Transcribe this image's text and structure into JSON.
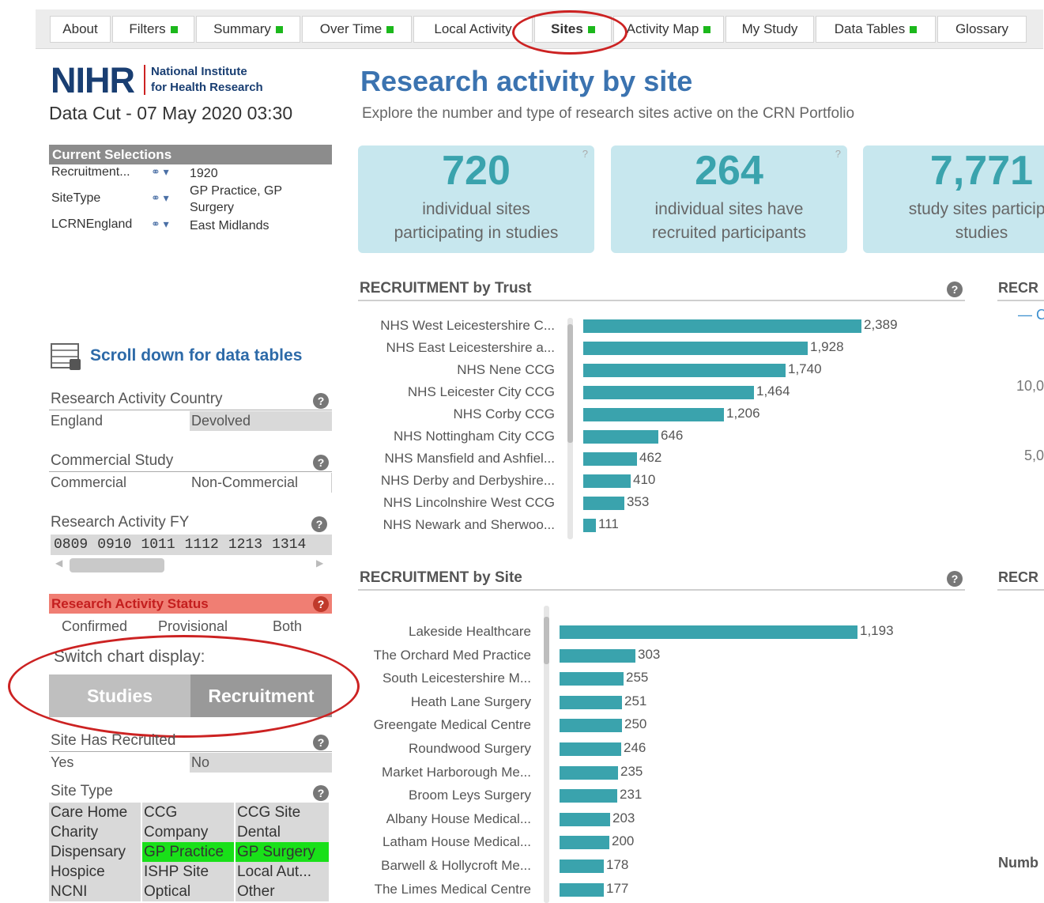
{
  "tabs": [
    {
      "label": "About",
      "dot": false
    },
    {
      "label": "Filters",
      "dot": true
    },
    {
      "label": "Summary",
      "dot": true
    },
    {
      "label": "Over Time",
      "dot": true
    },
    {
      "label": "Local Activity",
      "dot": false
    },
    {
      "label": "Sites",
      "dot": true,
      "active": true
    },
    {
      "label": "Activity Map",
      "dot": true
    },
    {
      "label": "My Study",
      "dot": false
    },
    {
      "label": "Data Tables",
      "dot": true
    },
    {
      "label": "Glossary",
      "dot": false
    }
  ],
  "logo": {
    "mark": "NIHR",
    "line1": "National Institute",
    "line2": "for Health Research"
  },
  "data_cut": "Data Cut - 07 May 2020 03:30",
  "current_selections": {
    "header": "Current Selections",
    "rows": [
      {
        "name": "Recruitment...",
        "value": "1920"
      },
      {
        "name": "SiteType",
        "value": "GP Practice, GP Surgery"
      },
      {
        "name": "LCRNEngland",
        "value": "East Midlands"
      }
    ]
  },
  "scroll_hint": "Scroll down for data tables",
  "filters": {
    "country": {
      "title": "Research Activity Country",
      "options": [
        "England",
        "Devolved"
      ]
    },
    "commercial": {
      "title": "Commercial Study",
      "options": [
        "Commercial",
        "Non-Commercial"
      ]
    },
    "fy": {
      "title": "Research Activity FY",
      "options": [
        "0809",
        "0910",
        "1011",
        "1112",
        "1213",
        "1314"
      ]
    },
    "status": {
      "title": "Research Activity Status",
      "options": [
        "Confirmed",
        "Provisional",
        "Both"
      ]
    },
    "switch": {
      "label": "Switch chart display:",
      "studies": "Studies",
      "recruitment": "Recruitment"
    },
    "recruited": {
      "title": "Site Has Recruited",
      "options": [
        "Yes",
        "No"
      ]
    },
    "site_type": {
      "title": "Site Type",
      "cells": [
        "Care Home",
        "CCG",
        "CCG Site",
        "Charity",
        "Company",
        "Dental",
        "Dispensary",
        "GP Practice",
        "GP Surgery",
        "Hospice",
        "ISHP Site",
        "Local Aut...",
        "NCNI",
        "Optical",
        "Other"
      ]
    }
  },
  "page": {
    "title": "Research activity by site",
    "subtitle": "Explore the number and type of research sites active on the CRN Portfolio"
  },
  "kpis": [
    {
      "value": "720",
      "line1": "individual sites",
      "line2": "participating in studies"
    },
    {
      "value": "264",
      "line1": "individual sites have",
      "line2": "recruited participants"
    },
    {
      "value": "7,771",
      "line1": "study sites participa",
      "line2": "studies"
    }
  ],
  "edge": {
    "recr1": "RECR",
    "legend_c": "— C",
    "tick_10": "10,0",
    "tick_5": "5,0",
    "recr2": "RECR",
    "numb": "Numb"
  },
  "chart_data": [
    {
      "type": "bar",
      "title": "RECRUITMENT by Trust",
      "orientation": "horizontal",
      "categories": [
        "NHS West Leicestershire C...",
        "NHS East Leicestershire a...",
        "NHS Nene CCG",
        "NHS Leicester City CCG",
        "NHS Corby CCG",
        "NHS Nottingham City CCG",
        "NHS Mansfield and Ashfiel...",
        "NHS Derby and Derbyshire...",
        "NHS Lincolnshire West CCG",
        "NHS Newark and Sherwoo..."
      ],
      "values": [
        2389,
        1928,
        1740,
        1464,
        1206,
        646,
        462,
        410,
        353,
        111
      ],
      "labels": [
        "2,389",
        "1,928",
        "1,740",
        "1,464",
        "1,206",
        "646",
        "462",
        "410",
        "353",
        "111"
      ],
      "xlim": [
        0,
        2389
      ]
    },
    {
      "type": "bar",
      "title": "RECRUITMENT by Site",
      "orientation": "horizontal",
      "categories": [
        "Lakeside Healthcare",
        "The Orchard Med Practice",
        "South Leicestershire M...",
        "Heath Lane Surgery",
        "Greengate Medical Centre",
        "Roundwood Surgery",
        "Market Harborough Me...",
        "Broom Leys Surgery",
        "Albany House Medical...",
        "Latham House Medical...",
        "Barwell & Hollycroft Me...",
        "The Limes Medical Centre"
      ],
      "values": [
        1193,
        303,
        255,
        251,
        250,
        246,
        235,
        231,
        203,
        200,
        178,
        177
      ],
      "labels": [
        "1,193",
        "303",
        "255",
        "251",
        "250",
        "246",
        "235",
        "231",
        "203",
        "200",
        "178",
        "177"
      ],
      "xlim": [
        0,
        1193
      ]
    }
  ]
}
